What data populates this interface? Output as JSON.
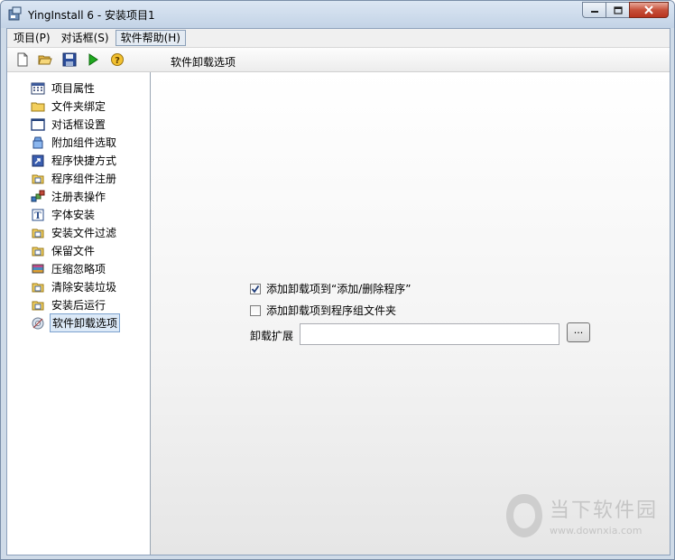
{
  "window": {
    "title": "YingInstall 6 - 安装项目1"
  },
  "menu": {
    "items": [
      {
        "label": "项目(P)"
      },
      {
        "label": "对话框(S)"
      },
      {
        "label": "软件帮助(H)"
      }
    ]
  },
  "toolbar": {
    "caption": "软件卸载选项"
  },
  "sidebar": {
    "items": [
      {
        "label": "项目属性",
        "icon": "grid-icon"
      },
      {
        "label": "文件夹绑定",
        "icon": "folder-icon"
      },
      {
        "label": "对话框设置",
        "icon": "window-icon"
      },
      {
        "label": "附加组件选取",
        "icon": "component-icon"
      },
      {
        "label": "程序快捷方式",
        "icon": "shortcut-icon"
      },
      {
        "label": "程序组件注册",
        "icon": "register-icon"
      },
      {
        "label": "注册表操作",
        "icon": "registry-icon"
      },
      {
        "label": "字体安装",
        "icon": "font-icon"
      },
      {
        "label": "安装文件过滤",
        "icon": "filter-icon"
      },
      {
        "label": "保留文件",
        "icon": "keep-file-icon"
      },
      {
        "label": "压缩忽略项",
        "icon": "compress-icon"
      },
      {
        "label": "清除安装垃圾",
        "icon": "clean-icon"
      },
      {
        "label": "安装后运行",
        "icon": "run-after-icon"
      },
      {
        "label": "软件卸载选项",
        "icon": "uninstall-icon"
      }
    ]
  },
  "content": {
    "checkbox_add_remove": {
      "label": "添加卸载项到“添加/删除程序”",
      "checked": true
    },
    "checkbox_program_group": {
      "label": "添加卸载项到程序组文件夹",
      "checked": false
    },
    "uninstall_ext": {
      "label": "卸载扩展",
      "value": ""
    },
    "browse_label": "..."
  },
  "watermark": {
    "text": "当下软件园",
    "url": "www.downxia.com"
  }
}
